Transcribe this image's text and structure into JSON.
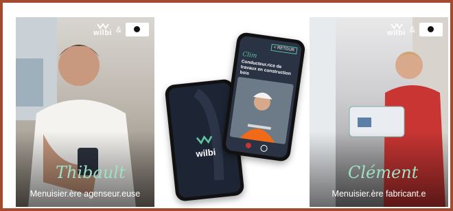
{
  "brand": {
    "name": "wilbi",
    "ampersand": "&"
  },
  "cards": [
    {
      "script_name": "Thibault",
      "role": "Menuisier.ère agenseur.euse"
    },
    {
      "script_name": "Clément",
      "role": "Menuisier.ère fabricant.e"
    }
  ],
  "phone_back": {
    "brand": "wilbi"
  },
  "phone_front": {
    "back_label": "< RETOUR",
    "script_name": "Clim",
    "headline": "Conducteur.rice de travaux en construction bois"
  },
  "colors": {
    "frame": "#a44a2e",
    "accent": "#5ec4a2",
    "dark": "#1d2433"
  }
}
